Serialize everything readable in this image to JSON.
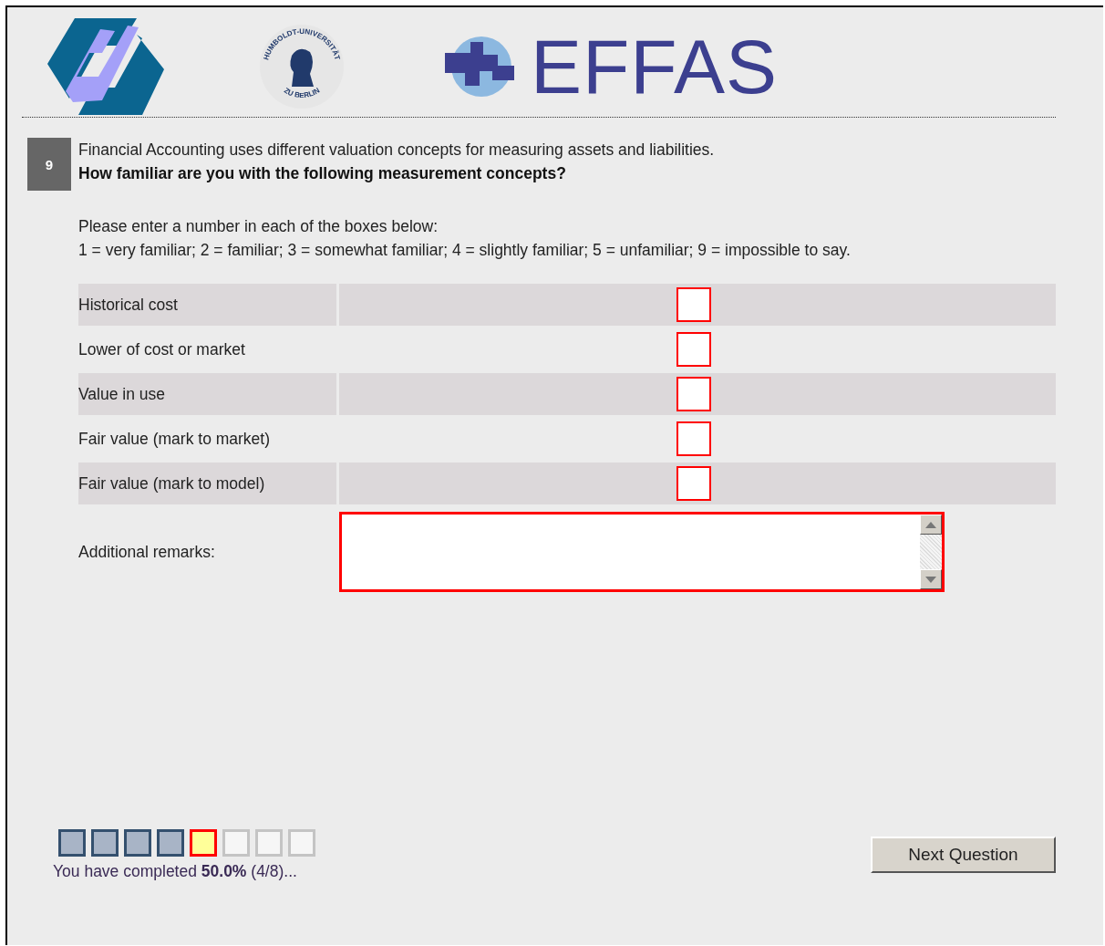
{
  "header": {
    "seal_text_top": "HUMBOLDT-UNIVERSITÄT",
    "seal_text_bottom": "ZU BERLIN",
    "brand": "EFFAS"
  },
  "question": {
    "number": "9",
    "intro": "Financial Accounting uses different valuation concepts for measuring assets and liabilities.",
    "prompt": "How familiar are you with the following measurement concepts?",
    "instruction": "Please enter a number in each of the boxes below:",
    "scale": "1 = very familiar; 2 = familiar; 3 = somewhat familiar; 4 = slightly familiar; 5 = unfamiliar; 9 = impossible to say."
  },
  "items": [
    {
      "label": "Historical cost",
      "invalid": true
    },
    {
      "label": "Lower of cost or market",
      "invalid": true
    },
    {
      "label": "Value in use",
      "invalid": true
    },
    {
      "label": "Fair value (mark to market)",
      "invalid": true
    },
    {
      "label": "Fair value (mark to model)",
      "invalid": true
    }
  ],
  "remarks": {
    "label": "Additional remarks:",
    "invalid": true
  },
  "progress": {
    "steps": [
      {
        "completed": true,
        "current": false
      },
      {
        "completed": true,
        "current": false
      },
      {
        "completed": true,
        "current": false
      },
      {
        "completed": true,
        "current": false
      },
      {
        "completed": false,
        "current": true
      },
      {
        "completed": false,
        "current": false
      },
      {
        "completed": false,
        "current": false
      },
      {
        "completed": false,
        "current": false
      }
    ],
    "text": "You have completed **50.0%** (4/8)..."
  },
  "next_button": "Next Question"
}
